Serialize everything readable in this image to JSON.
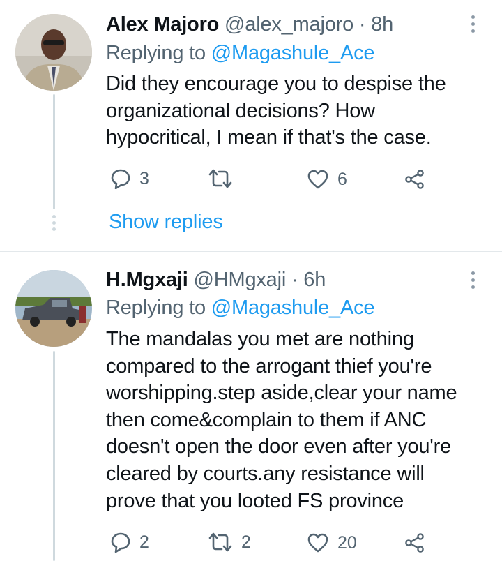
{
  "tweets": [
    {
      "name": "Alex Majoro",
      "handle": "@alex_majoro",
      "time": "· 8h",
      "replying_prefix": "Replying to",
      "replying_to": "@Magashule_Ace",
      "lines": [
        "Did they encourage you to despise the",
        "organizational decisions? How",
        "hypocritical, I mean if that's  the case."
      ],
      "replies": "3",
      "retweets": "",
      "likes": "6",
      "show_replies": "Show replies"
    },
    {
      "name": "H.Mgxaji",
      "handle": "@HMgxaji",
      "time": "· 6h",
      "replying_prefix": "Replying to",
      "replying_to": "@Magashule_Ace",
      "lines": [
        "The mandalas you met are nothing",
        "compared to the arrogant thief you're",
        "worshipping.step aside,clear your name",
        "then come&complain to them if ANC",
        "doesn't open the door even after you're",
        "cleared by courts.any resistance will",
        "prove that you looted FS province"
      ],
      "replies": "2",
      "retweets": "2",
      "likes": "20"
    }
  ],
  "icons": {
    "reply": "speech-bubble-icon",
    "retweet": "retweet-icon",
    "like": "heart-icon",
    "share": "share-icon",
    "more": "more-vertical-icon"
  },
  "colors": {
    "link": "#1d9bf0",
    "secondary_text": "#536471",
    "thread_line": "#cfd9de"
  }
}
